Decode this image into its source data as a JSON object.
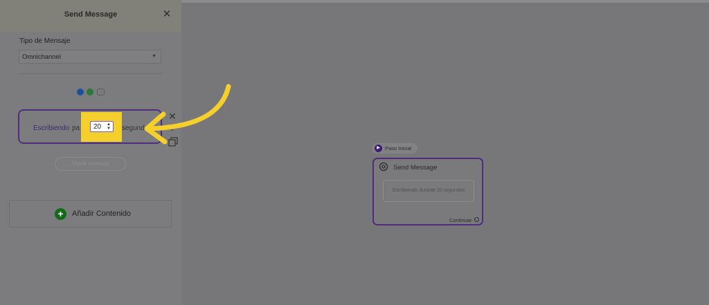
{
  "panel": {
    "title": "Send Message",
    "type_label": "Tipo de Mensaje",
    "type_value": "Omnichannel",
    "channels": [
      {
        "icon": "messenger-icon",
        "color": "#1d4f9e"
      },
      {
        "icon": "whatsapp-icon",
        "color": "#2a7a36"
      },
      {
        "icon": "chat-bubble-icon",
        "color": "#5c5c5e"
      }
    ],
    "typing_card": {
      "label": "Escribiendo",
      "para": "pa",
      "seconds_value": "20",
      "segundos": "segundo"
    },
    "ghost_button": "Añadir mensaje",
    "add_content": "Añadir Contenido"
  },
  "canvas": {
    "start_label": "Paso Inicial",
    "node": {
      "title": "Send Message",
      "body": "Escribiendo durante 20 segundos",
      "continue_label": "Continuar"
    }
  },
  "colors": {
    "accent_purple": "#4e2d7e",
    "highlight_yellow": "#f5d02c",
    "add_green": "#136b1a"
  }
}
